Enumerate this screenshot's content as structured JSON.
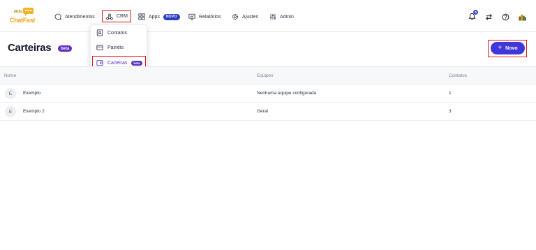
{
  "app": {
    "logo_text": "ChatFast",
    "logo_sub": "Mídia"
  },
  "nav": {
    "items": [
      {
        "label": "Atendimentos",
        "icon": "chat-bubble-icon"
      },
      {
        "label": "CRM",
        "icon": "crm-nodes-icon"
      },
      {
        "label": "Apps",
        "icon": "apps-grid-icon",
        "badge": "NOVO"
      },
      {
        "label": "Relatórios",
        "icon": "reports-icon"
      },
      {
        "label": "Ajustes",
        "icon": "gear-icon"
      },
      {
        "label": "Admin",
        "icon": "sliders-icon"
      }
    ],
    "notifications_count": "0"
  },
  "crm_menu": {
    "items": [
      {
        "label": "Contatos",
        "icon": "contact-card-icon"
      },
      {
        "label": "Painéis",
        "icon": "panels-icon"
      },
      {
        "label": "Carteiras",
        "icon": "wallet-icon",
        "badge": "beta"
      }
    ]
  },
  "page": {
    "title": "Carteiras",
    "title_badge": "beta",
    "new_button": "Novo"
  },
  "table": {
    "headers": {
      "nome": "Nome",
      "equipes": "Equipes",
      "contatos": "Contatos"
    },
    "rows": [
      {
        "avatar": "E",
        "nome": "Exemplo",
        "equipes": "Nenhuma equipe configurada",
        "contatos": "1"
      },
      {
        "avatar": "E",
        "nome": "Exemplo 2",
        "equipes": "Geral",
        "contatos": "3"
      }
    ]
  },
  "colors": {
    "accent": "#4136d9",
    "beta": "#5b2fc0",
    "highlight": "#e0161b",
    "logo": "#e8a620"
  }
}
